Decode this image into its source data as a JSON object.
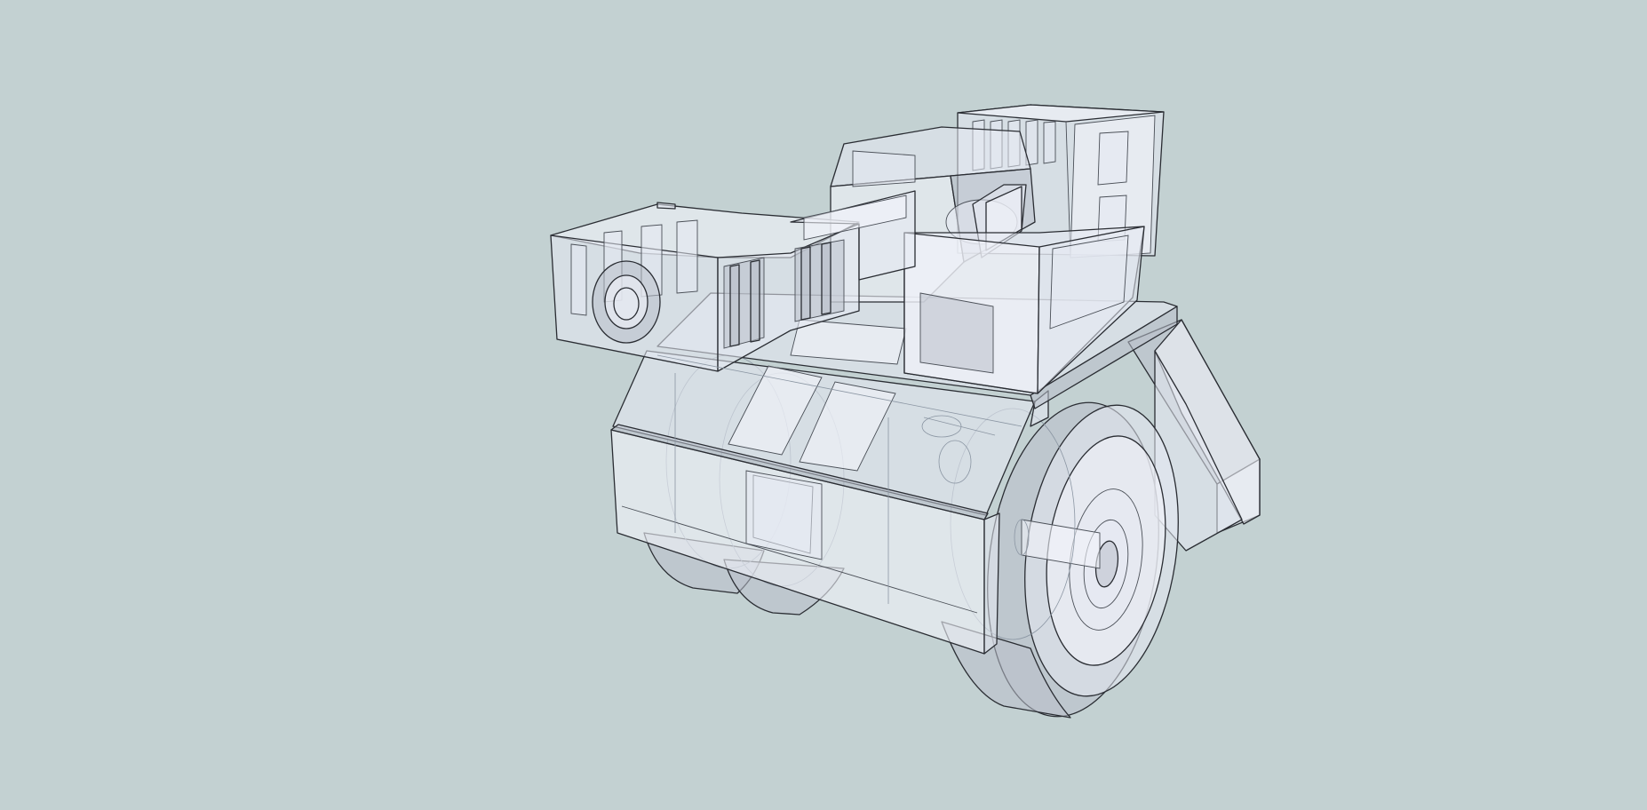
{
  "viewport": {
    "background_color": "#c3d1d2",
    "render_style": "x-ray",
    "model_name": "",
    "edge_color": "#2a2d33",
    "face_color": "#e6e9f3"
  }
}
